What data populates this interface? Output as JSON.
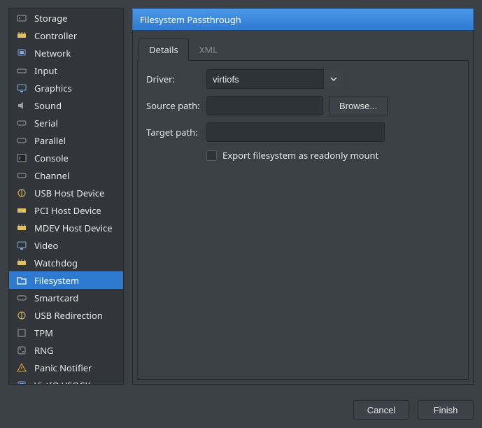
{
  "sidebar": {
    "items": [
      {
        "label": "Storage",
        "icon": "storage"
      },
      {
        "label": "Controller",
        "icon": "controller"
      },
      {
        "label": "Network",
        "icon": "network"
      },
      {
        "label": "Input",
        "icon": "input"
      },
      {
        "label": "Graphics",
        "icon": "graphics"
      },
      {
        "label": "Sound",
        "icon": "sound"
      },
      {
        "label": "Serial",
        "icon": "serial"
      },
      {
        "label": "Parallel",
        "icon": "parallel"
      },
      {
        "label": "Console",
        "icon": "console"
      },
      {
        "label": "Channel",
        "icon": "channel"
      },
      {
        "label": "USB Host Device",
        "icon": "usb"
      },
      {
        "label": "PCI Host Device",
        "icon": "pci"
      },
      {
        "label": "MDEV Host Device",
        "icon": "mdev"
      },
      {
        "label": "Video",
        "icon": "video"
      },
      {
        "label": "Watchdog",
        "icon": "watchdog"
      },
      {
        "label": "Filesystem",
        "icon": "filesystem",
        "selected": true
      },
      {
        "label": "Smartcard",
        "icon": "smartcard"
      },
      {
        "label": "USB Redirection",
        "icon": "usbredir"
      },
      {
        "label": "TPM",
        "icon": "tpm"
      },
      {
        "label": "RNG",
        "icon": "rng"
      },
      {
        "label": "Panic Notifier",
        "icon": "panic"
      },
      {
        "label": "VirtIO VSOCK",
        "icon": "vsock"
      }
    ]
  },
  "header": {
    "title": "Filesystem Passthrough"
  },
  "tabs": [
    {
      "label": "Details",
      "active": true
    },
    {
      "label": "XML",
      "active": false
    }
  ],
  "form": {
    "driver_label": "Driver:",
    "driver_value": "virtiofs",
    "source_label": "Source path:",
    "source_value": "",
    "browse_label": "Browse...",
    "target_label": "Target path:",
    "target_value": "",
    "readonly_label": "Export filesystem as readonly mount",
    "readonly_checked": false
  },
  "footer": {
    "cancel": "Cancel",
    "finish": "Finish"
  }
}
